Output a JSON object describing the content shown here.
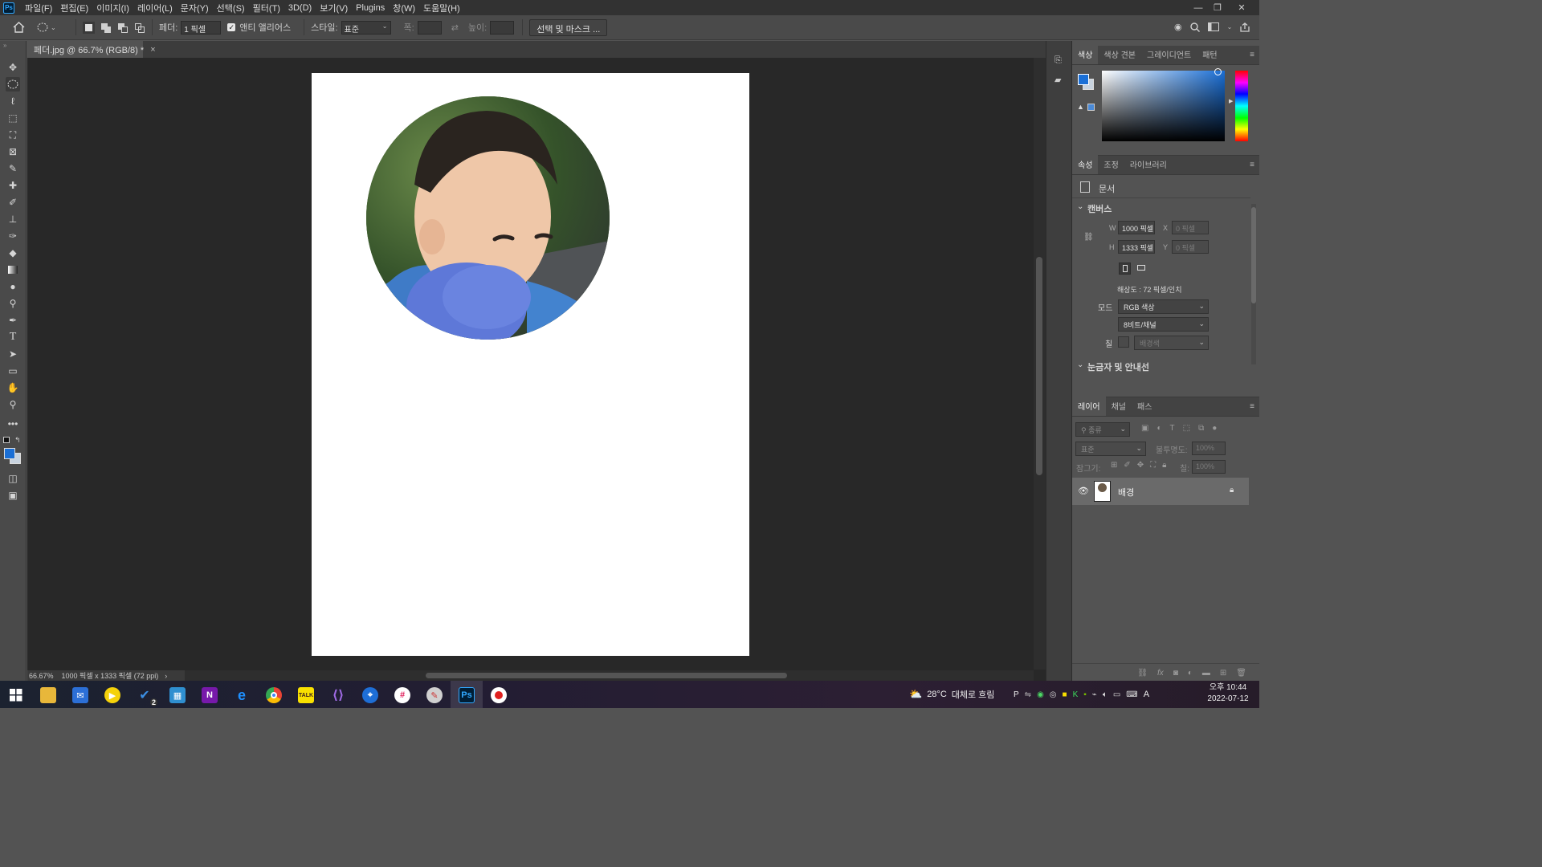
{
  "menubar": {
    "app_logo": "Ps",
    "items": [
      "파일(F)",
      "편집(E)",
      "이미지(I)",
      "레이어(L)",
      "문자(Y)",
      "선택(S)",
      "필터(T)",
      "3D(D)",
      "보기(V)",
      "Plugins",
      "창(W)",
      "도움말(H)"
    ],
    "window_controls": [
      "—",
      "❐",
      "✕"
    ]
  },
  "options": {
    "feather_label": "페더:",
    "feather_value": "1 픽셀",
    "antialias_label": "앤티 앨리어스",
    "antialias_checked": true,
    "style_label": "스타일:",
    "style_value": "표준",
    "width_label": "폭:",
    "height_label": "높이:",
    "select_mask_button": "선택 및 마스크 ..."
  },
  "document": {
    "tab_title": "페더.jpg @ 66.7% (RGB/8) *",
    "tab_close": "×",
    "zoom": "66.67%",
    "doc_info": "1000 픽셀 x 1333 픽셀 (72 ppi)"
  },
  "color_panel": {
    "tabs": [
      "색상",
      "색상 견본",
      "그레이디언트",
      "패턴"
    ],
    "active_tab": "색상",
    "foreground": "#1a6fd6",
    "background": "#c8d3df"
  },
  "properties_panel": {
    "tabs": [
      "속성",
      "조정",
      "라이브러리"
    ],
    "doc_label": "문서",
    "canvas_section": "캔버스",
    "w_label": "W",
    "w_value": "1000 픽셀",
    "h_label": "H",
    "h_value": "1333 픽셀",
    "x_label": "X",
    "x_value": "0 픽셀",
    "y_label": "Y",
    "y_value": "0 픽셀",
    "resolution": "해상도 : 72 픽셀/인치",
    "mode_label": "모드",
    "mode_value": "RGB 색상",
    "depth_value": "8비트/채널",
    "fill_label": "칠",
    "fill_value": "배경색",
    "rulers_section": "눈금자 및 안내선"
  },
  "layers_panel": {
    "tabs": [
      "레이어",
      "채널",
      "패스"
    ],
    "filter_placeholder": "종류",
    "blend_mode": "표준",
    "opacity_label": "불투명도:",
    "opacity_value": "100%",
    "lock_label": "잠그기:",
    "fill_label": "칠:",
    "fill_value": "100%",
    "layers": [
      {
        "name": "배경",
        "visible": true,
        "locked": true
      }
    ]
  },
  "taskbar": {
    "weather_temp": "28°C",
    "weather_text": "대체로 흐림",
    "time": "오후 10:44",
    "date": "2022-07-12",
    "ime": "A",
    "badge": "2"
  }
}
